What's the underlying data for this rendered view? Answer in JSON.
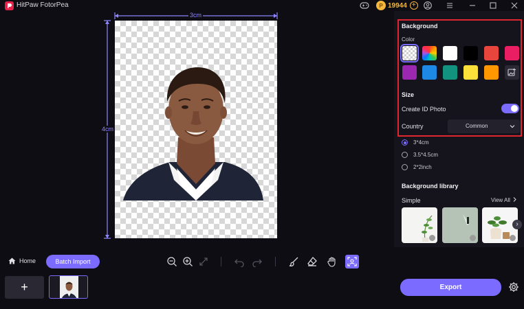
{
  "app": {
    "title": "HitPaw FotorPea"
  },
  "titlebar": {
    "coins": "19944",
    "coin_symbol": "P",
    "add_symbol": "+"
  },
  "canvas": {
    "width_label": "3cm",
    "height_label": "4cm"
  },
  "panel": {
    "background_title": "Background",
    "color_label": "Color",
    "size_title": "Size",
    "create_id_label": "Create ID Photo",
    "create_id_on": true,
    "country_label": "Country",
    "country_value": "Common",
    "size_options": [
      {
        "label": "3*4cm",
        "selected": true
      },
      {
        "label": "3.5*4.5cm",
        "selected": false
      },
      {
        "label": "2*2inch",
        "selected": false
      }
    ],
    "library_title": "Background library",
    "simple_label": "Simple",
    "view_all": "View All",
    "next_symbol": "›"
  },
  "colors": {
    "accent": "#7b6cff",
    "highlight": "#e0262e",
    "swatches": [
      "transparent",
      "rainbow",
      "#ffffff",
      "#000000",
      "#e8453c",
      "#e91e63",
      "#9c27b0",
      "#1e88e5",
      "#11937f",
      "#fde13b",
      "#ff9800",
      "custom"
    ]
  },
  "toolbar": {
    "home_label": "Home",
    "batch_label": "Batch Import"
  },
  "bottom": {
    "add_symbol": "+",
    "export_label": "Export"
  }
}
